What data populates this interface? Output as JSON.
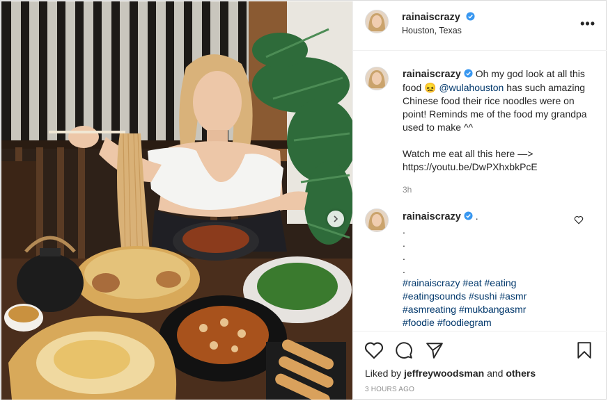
{
  "post": {
    "username": "rainaiscrazy",
    "location": "Houston, Texas"
  },
  "caption": {
    "username": "rainaiscrazy",
    "text_1": "Oh my god look at all this food",
    "emoji": "😖",
    "mention": "@wulahouston",
    "text_2": "has such amazing Chinese food their rice noodles were on point! Reminds me of the food my grandpa used to make ^^",
    "text_3": "Watch me eat all this here —>",
    "link": "https://youtu.be/DwPXhxbkPcE",
    "time": "3h"
  },
  "comment": {
    "username": "rainaiscrazy",
    "trail": ".",
    "dots": [
      ".",
      ".",
      ".",
      "."
    ],
    "hashtags_line1": [
      "#rainaiscrazy",
      "#eat",
      "#eating"
    ],
    "hashtags_line2": [
      "#eatingsounds",
      "#sushi",
      "#asmr"
    ],
    "hashtags_line3": [
      "#asmreating",
      "#mukbangasmr"
    ],
    "hashtags_line4": [
      "#foodie",
      "#foodiegram"
    ]
  },
  "likes": {
    "prefix": "Liked by",
    "user": "jeffreywoodsman",
    "and": "and",
    "others": "others"
  },
  "timestamp": "3 HOURS AGO",
  "colors": {
    "verified": "#3897f0",
    "link": "#00376b",
    "muted": "#8e8e8e"
  },
  "icons": [
    "more-options-icon",
    "verified-icon",
    "heart-icon",
    "comment-icon",
    "share-icon",
    "bookmark-icon",
    "carousel-next-icon"
  ]
}
